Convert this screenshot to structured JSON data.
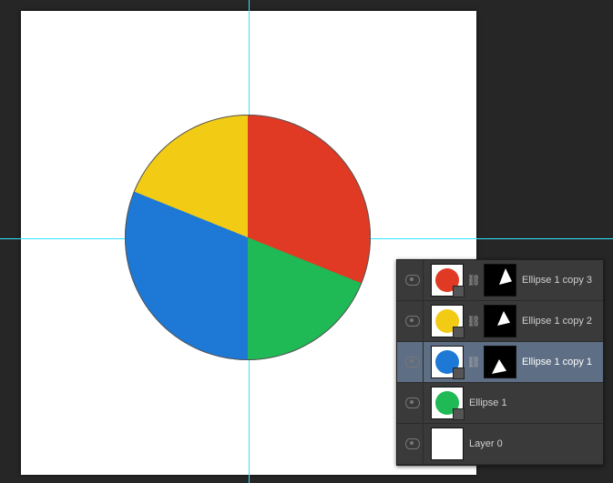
{
  "guides": {
    "vertical_x": 273,
    "horizontal_y": 262
  },
  "chart_data": {
    "type": "pie",
    "title": "",
    "series": [
      {
        "name": "Ellipse 1 copy 3",
        "color": "#e03a24",
        "start_deg": 8,
        "end_deg": 112
      },
      {
        "name": "Ellipse 1",
        "color": "#1fb955",
        "start_deg": 112,
        "end_deg": 180
      },
      {
        "name": "Ellipse 1 copy 1",
        "color": "#1e79d6",
        "start_deg": 180,
        "end_deg": 292
      },
      {
        "name": "Ellipse 1 copy 2",
        "color": "#f2cb15",
        "start_deg": 292,
        "end_deg": 368
      }
    ],
    "values_pct": [
      28.9,
      18.9,
      31.1,
      21.1
    ]
  },
  "layers_panel": {
    "rows": [
      {
        "name": "Ellipse 1 copy 3",
        "thumb_color": "#e03a24",
        "has_mask": true,
        "selected": false
      },
      {
        "name": "Ellipse 1 copy 2",
        "thumb_color": "#f2cb15",
        "has_mask": true,
        "selected": false
      },
      {
        "name": "Ellipse 1 copy 1",
        "thumb_color": "#1e79d6",
        "has_mask": true,
        "selected": true
      },
      {
        "name": "Ellipse 1",
        "thumb_color": "#1fb955",
        "has_mask": false,
        "selected": false
      },
      {
        "name": "Layer 0",
        "thumb_color": "#ffffff",
        "has_mask": false,
        "selected": false
      }
    ]
  }
}
